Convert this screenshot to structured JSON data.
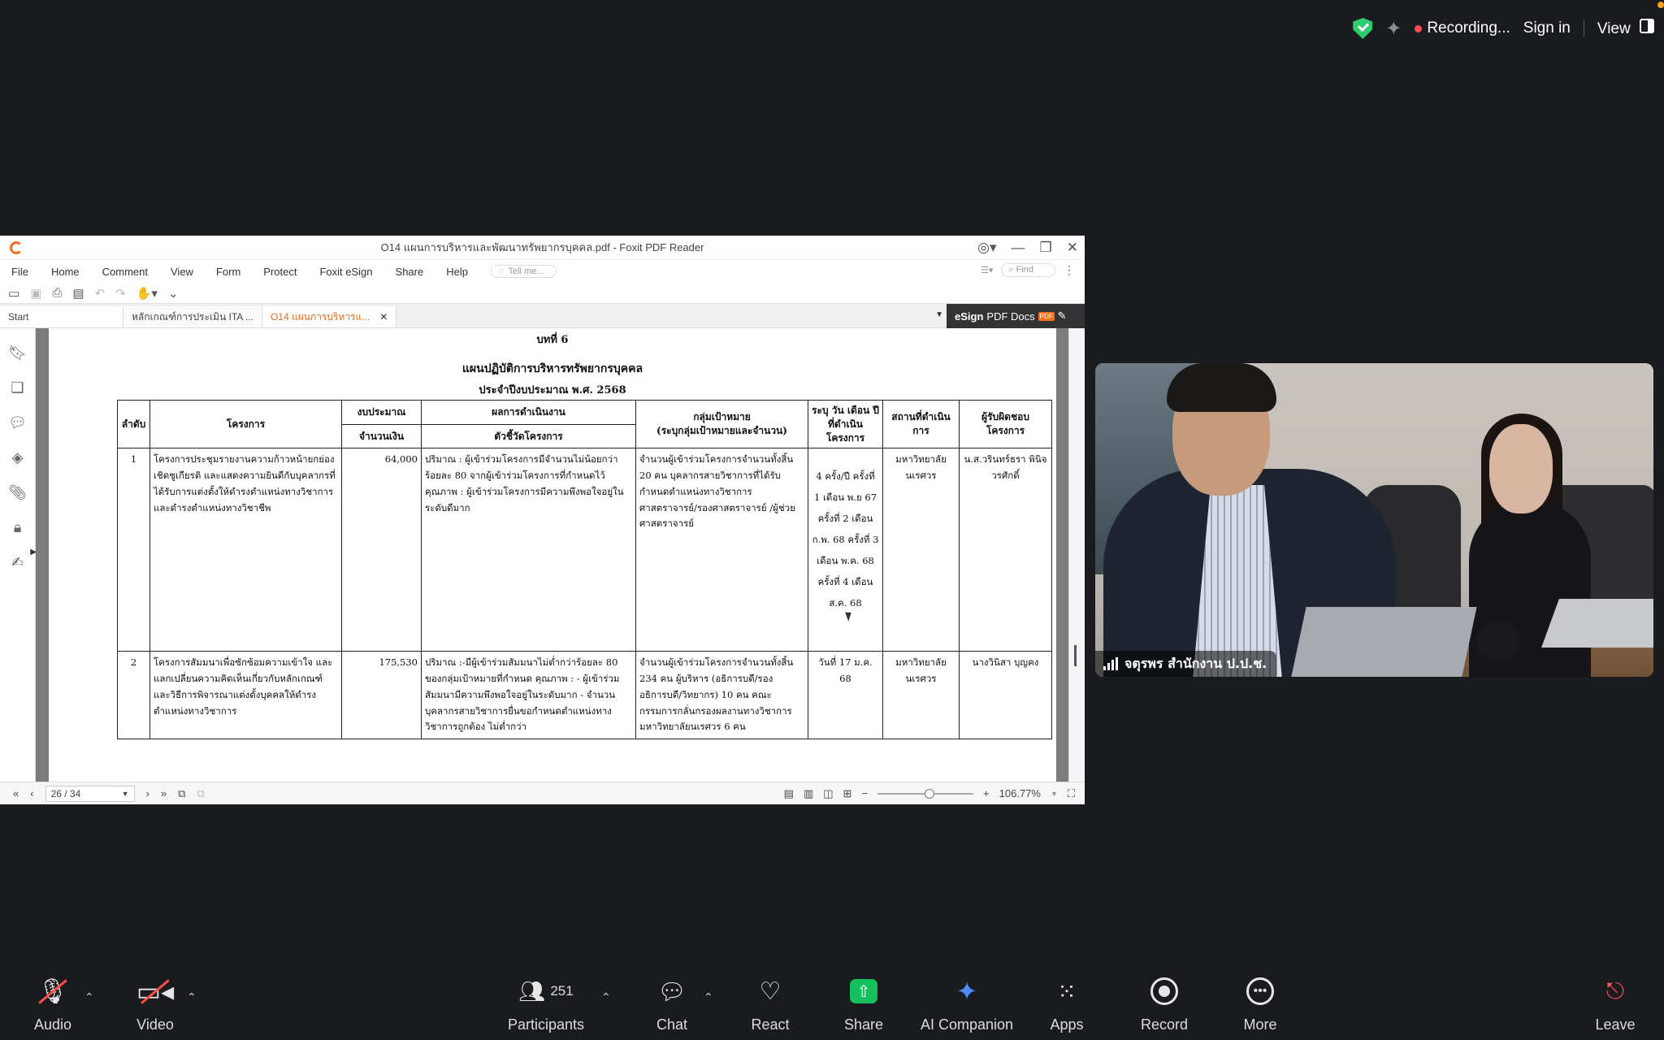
{
  "zoom": {
    "recording_label": "Recording...",
    "sign_in": "Sign in",
    "view": "View",
    "toolbar": {
      "audio": "Audio",
      "video": "Video",
      "participants": "Participants",
      "participants_count": "251",
      "chat": "Chat",
      "react": "React",
      "share": "Share",
      "ai_companion": "AI Companion",
      "apps": "Apps",
      "record": "Record",
      "more": "More",
      "leave": "Leave"
    },
    "participant_name": "จตุรพร สำนักงาน ป.ป.ช."
  },
  "foxit": {
    "window_title": "O14 แผนการบริหารและพัฒนาทรัพยากรบุคคล.pdf - Foxit PDF Reader",
    "menu": [
      "File",
      "Home",
      "Comment",
      "View",
      "Form",
      "Protect",
      "Foxit eSign",
      "Share",
      "Help"
    ],
    "tell_me": "Tell me...",
    "find": "Find",
    "tabs": {
      "start": "Start",
      "tab1": "หลักเกณฑ์การประเมิน ITA ...",
      "tab2": "O14 แผนการบริหารแ..."
    },
    "esign_bold": "eSign",
    "esign_rest": "PDF Docs",
    "esign_badge": "PDF",
    "page_indicator": "26 / 34",
    "zoom_level": "106.77%"
  },
  "document": {
    "chapter": "บทที่ 6",
    "title": "แผนปฏิบัติการบริหารทรัพยากรบุคคล",
    "subtitle": "ประจำปีงบประมาณ พ.ศ. 2568",
    "headers": {
      "no": "ลำดับ",
      "project": "โครงการ",
      "budget": "งบประมาณ",
      "budget_sub": "จำนวนเงิน",
      "result": "ผลการดำเนินงาน",
      "result_sub": "ตัวชี้วัดโครงการ",
      "target": "กลุ่มเป้าหมาย",
      "target_sub": "(ระบุกลุ่มเป้าหมายและจำนวน)",
      "period": "ระบุ วัน เดือน ปี ที่ดำเนินโครงการ",
      "place": "สถานที่ดำเนินการ",
      "owner": "ผู้รับผิดชอบโครงการ"
    },
    "rows": [
      {
        "no": "1",
        "project": "โครงการประชุมรายงานความก้าวหน้ายกย่องเชิดชูเกียรติ และแสดงความยินดีกับบุคลากรที่ได้รับการแต่งตั้งให้ดำรงตำแหน่งทางวิชาการ และดำรงตำแหน่งทางวิชาชีพ",
        "budget": "64,000",
        "indicator": "ปริมาณ : ผู้เข้าร่วมโครงการมีจำนวนไม่น้อยกว่าร้อยละ 80 จากผู้เข้าร่วมโครงการที่กำหนดไว้ คุณภาพ : ผู้เข้าร่วมโครงการมีความพึงพอใจอยู่ในระดับดีมาก",
        "target": "จำนวนผู้เข้าร่วมโครงการจำนวนทั้งสิ้น 20 คน บุคลากรสายวิชาการที่ได้รับกำหนดตำแหน่งทางวิชาการ ศาสตราจารย์/รองศาสตราจารย์ /ผู้ช่วยศาสตราจารย์",
        "period": "4 ครั้ง/ปี ครั้งที่ 1 เดือน พ.ย 67 ครั้งที่ 2 เดือน ก.พ. 68 ครั้งที่ 3 เดือน พ.ค. 68 ครั้งที่ 4 เดือน ส.ค. 68",
        "place": "มหาวิทยาลัยนเรศวร",
        "owner": "น.ส.วรินทร์ธรา พินิจวรศักดิ์"
      },
      {
        "no": "2",
        "project": "โครงการสัมมนาเพื่อซักซ้อมความเข้าใจ และแลกเปลี่ยนความคิดเห็นเกี่ยวกับหลักเกณฑ์และวิธีการพิจารณาแต่งตั้งบุคคลให้ดำรงตำแหน่งทางวิชาการ",
        "budget": "175,530",
        "indicator": "ปริมาณ :-มีผู้เข้าร่วมสัมมนาไม่ต่ำกว่าร้อยละ 80 ของกลุ่มเป้าหมายที่กำหนด คุณภาพ : - ผู้เข้าร่วมสัมมนามีความพึงพอใจอยู่ในระดับมาก - จำนวนบุคลากรสายวิชาการยื่นขอกำหนดตำแหน่งทางวิชาการถูกต้อง ไม่ต่ำกว่า",
        "target": "จำนวนผู้เข้าร่วมโครงการจำนวนทั้งสิ้น 234 คน ผู้บริหาร (อธิการบดี/รองอธิการบดี/วิทยากร) 10 คน คณะกรรมการกลั่นกรองผลงานทางวิชาการ มหาวิทยาลัยนเรศวร 6 คน",
        "period": "วันที่ 17 ม.ค. 68",
        "place": "มหาวิทยาลัยนเรศวร",
        "owner": "นางวินิสา บุญคง"
      }
    ]
  }
}
